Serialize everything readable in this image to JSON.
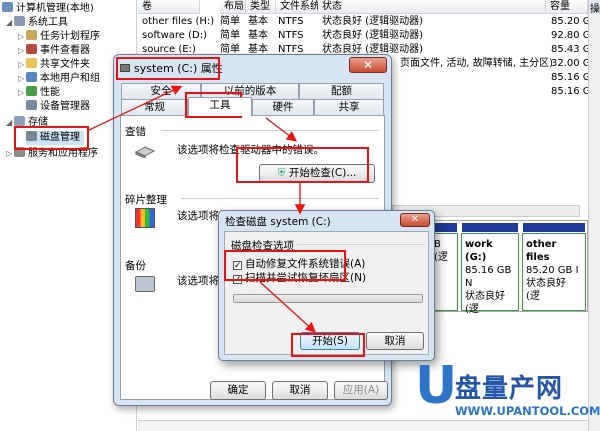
{
  "tree": {
    "root": "计算机管理(本地)",
    "items": [
      {
        "label": "系统工具",
        "level": 0
      },
      {
        "label": "任务计划程序",
        "level": 1
      },
      {
        "label": "事件查看器",
        "level": 1
      },
      {
        "label": "共享文件夹",
        "level": 1
      },
      {
        "label": "本地用户和组",
        "level": 1
      },
      {
        "label": "性能",
        "level": 1
      },
      {
        "label": "设备管理器",
        "level": 1
      },
      {
        "label": "存储",
        "level": 0
      },
      {
        "label": "磁盘管理",
        "level": 1
      },
      {
        "label": "服务和应用程序",
        "level": 0
      }
    ]
  },
  "table": {
    "columns": [
      "卷",
      "布局",
      "类型",
      "文件系统",
      "状态",
      "容量",
      "操"
    ],
    "rows": [
      [
        "other files (H:)",
        "简单",
        "基本",
        "NTFS",
        "状态良好 (逻辑驱动器)",
        "85.20 G"
      ],
      [
        "software (D:)",
        "简单",
        "基本",
        "NTFS",
        "状态良好 (逻辑驱动器)",
        "92.80 G"
      ],
      [
        "source (E:)",
        "简单",
        "基本",
        "NTFS",
        "状态良好 (逻辑驱动器)",
        "85.43 G"
      ],
      [
        "",
        "",
        "",
        "",
        "页面文件, 活动, 故障转储, 主分区)",
        "32.00 G"
      ],
      [
        "",
        "",
        "",
        "",
        "",
        "85.16 G"
      ],
      [
        "",
        "",
        "",
        "",
        "",
        "85.16 G"
      ]
    ]
  },
  "props": {
    "title": "system (C:) 属性",
    "tabs_top": [
      "安全",
      "以前的版本",
      "配额"
    ],
    "tabs_bottom": [
      "常规",
      "工具",
      "硬件",
      "共享"
    ],
    "error_check_title": "查错",
    "error_check_desc": "该选项将检查驱动器中的错误。",
    "start_check_button": "开始检查(C)...",
    "defrag_title": "碎片整理",
    "defrag_desc": "该选项将对驱动器中的文件进行碎片整理。",
    "backup_title": "备份",
    "backup_desc": "该选项将备",
    "ok_button": "确定",
    "cancel_button": "取消",
    "apply_button": "应用(A)"
  },
  "check_dialog": {
    "title": "检查磁盘 system (C:)",
    "options_title": "磁盘检查选项",
    "option1": "自动修复文件系统错误(A)",
    "option2": "扫描并尝试恢复坏扇区(N)",
    "start_button": "开始(S)",
    "cancel_button": "取消"
  },
  "disk_map": {
    "partitions": [
      {
        "name": "",
        "size": "B",
        "status": "(逻"
      },
      {
        "name": "work (G:)",
        "size": "85.16 GB N",
        "status": "状态良好 (逻"
      },
      {
        "name": "other files",
        "size": "85.20 GB I",
        "status": "状态良好 (逻"
      }
    ]
  },
  "logo": {
    "brand": "盘量产网",
    "url": "WWW.UPANTOOL.COM",
    "letter": "U"
  }
}
